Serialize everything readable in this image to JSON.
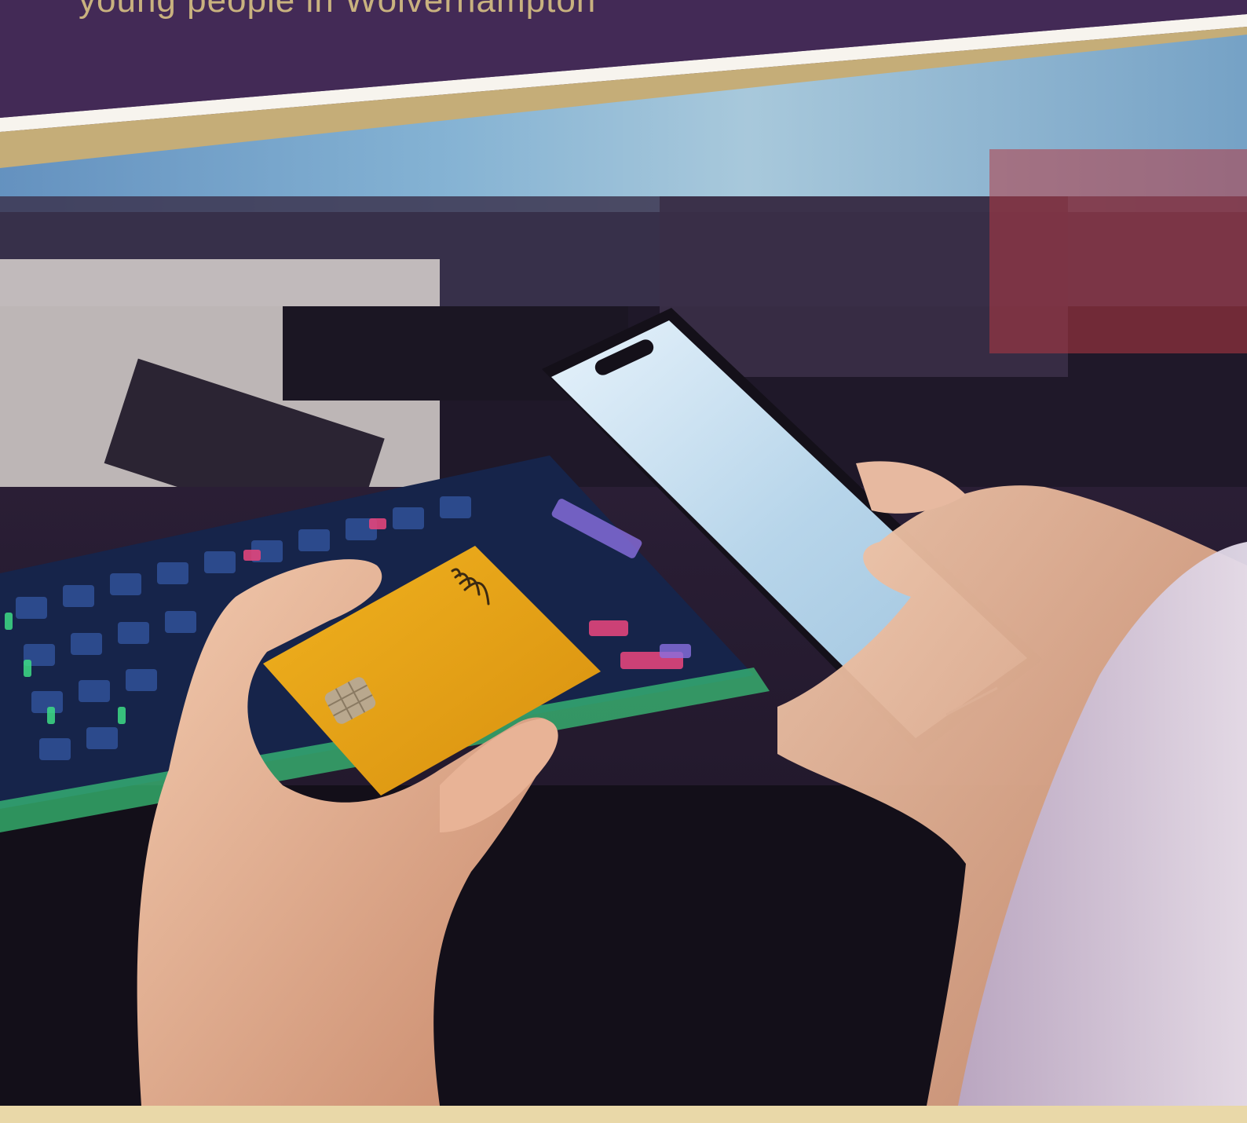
{
  "header": {
    "subtitle": "young people in Wolverhampton"
  },
  "colors": {
    "header_bg": "#432a56",
    "subtitle_text": "#c9b27f",
    "gold_stripe": "#c5ad78",
    "white_stripe": "#f7f4ee",
    "card_yellow": "#e3a21a",
    "bottom_strip": "#e9d8a8"
  },
  "photo": {
    "subject": "hands holding a yellow payment card and a smartphone in front of an illuminated gaming keyboard",
    "icons": [
      "contactless-icon",
      "chip-icon"
    ]
  }
}
